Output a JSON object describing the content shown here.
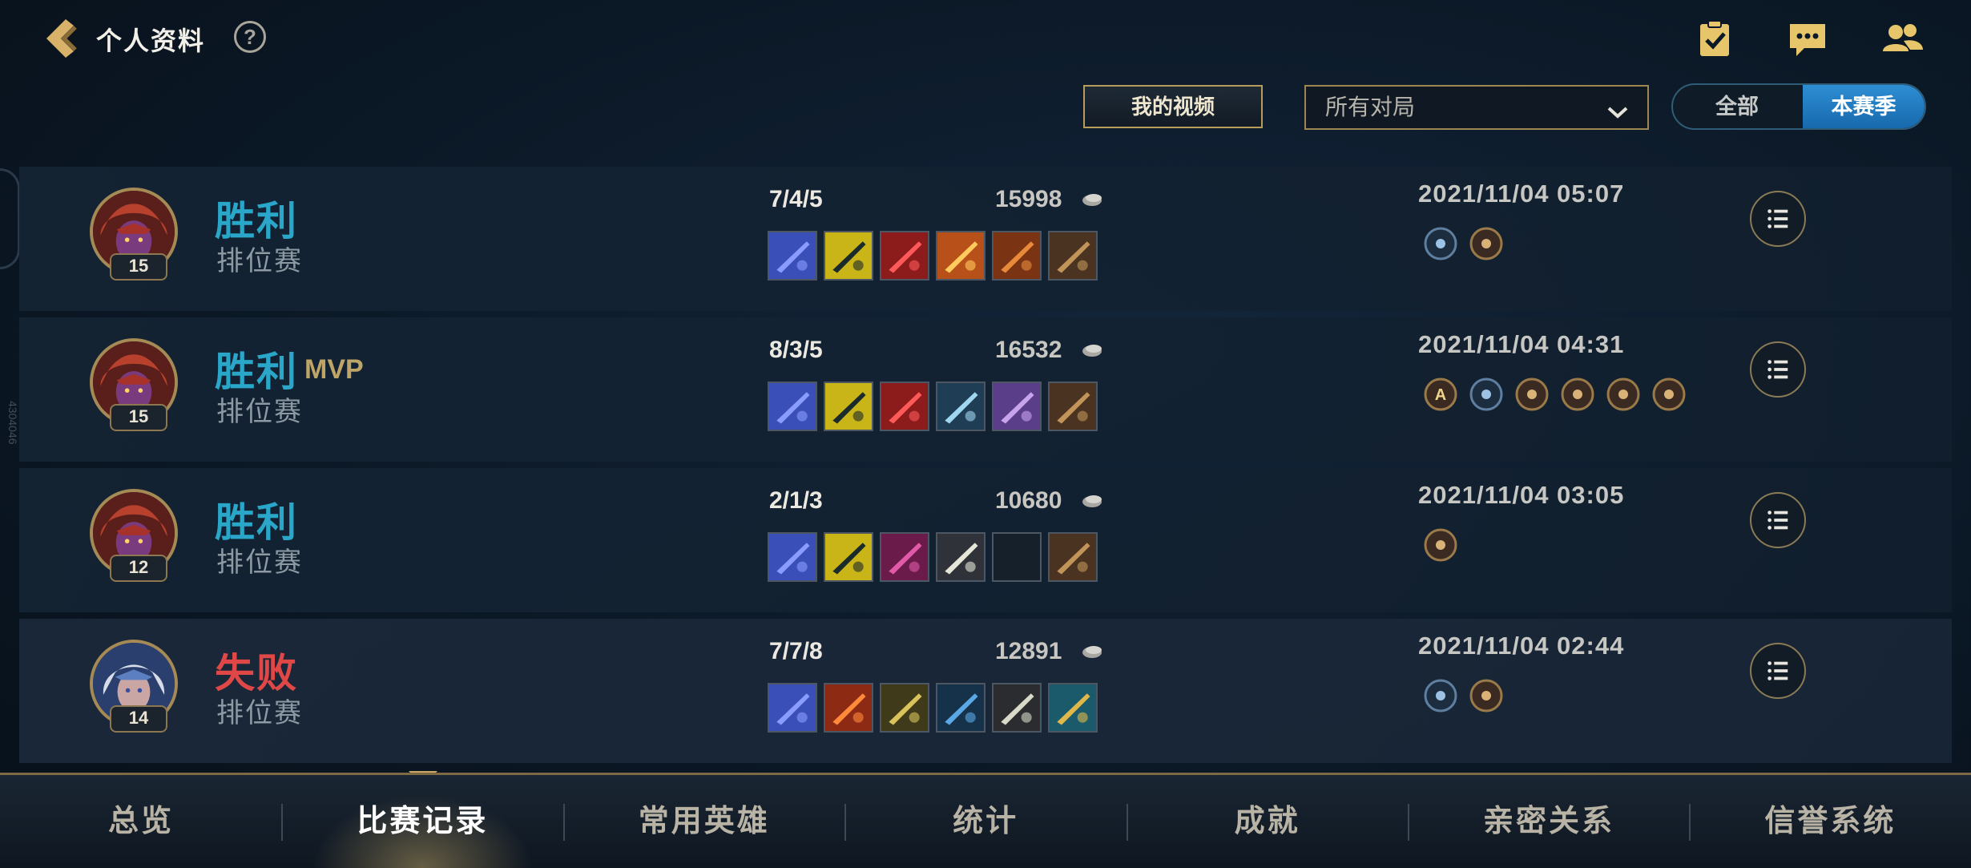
{
  "header": {
    "title": "个人资料",
    "help_label": "?"
  },
  "controls": {
    "video_button": "我的视频",
    "match_filter": "所有对局",
    "segment": [
      "全部",
      "本赛季"
    ],
    "segment_active": "本赛季"
  },
  "side_text": "4304046",
  "matches": [
    {
      "result": "胜利",
      "outcome": "win",
      "mvp": "",
      "mode": "排位赛",
      "level": "15",
      "kda": "7/4/5",
      "gold": "15998",
      "time": "2021/11/04 05:07",
      "badges": [
        "compass-badge",
        "crown-badge"
      ],
      "hero": "red-hero"
    },
    {
      "result": "胜利",
      "outcome": "win",
      "mvp": "MVP",
      "mode": "排位赛",
      "level": "15",
      "kda": "8/3/5",
      "gold": "16532",
      "time": "2021/11/04 04:31",
      "badges": [
        "assist-a-badge",
        "crown-blue-badge",
        "wallet-badge",
        "crown-badge",
        "tower-badge",
        "fist-badge"
      ],
      "hero": "red-hero"
    },
    {
      "result": "胜利",
      "outcome": "win",
      "mvp": "",
      "mode": "排位赛",
      "level": "12",
      "kda": "2/1/3",
      "gold": "10680",
      "time": "2021/11/04 03:05",
      "badges": [
        "crown-badge"
      ],
      "hero": "red-hero"
    },
    {
      "result": "失败",
      "outcome": "lose",
      "mvp": "",
      "mode": "排位赛",
      "level": "14",
      "kda": "7/7/8",
      "gold": "12891",
      "time": "2021/11/04 02:44",
      "badges": [
        "compass-badge",
        "drop-badge"
      ],
      "hero": "blue-hero"
    }
  ],
  "nav": {
    "tabs": [
      "总览",
      "比赛记录",
      "常用英雄",
      "统计",
      "成就",
      "亲密关系",
      "信誉系统"
    ],
    "active": "比赛记录"
  },
  "colors": {
    "win": "#2aa6c9",
    "lose": "#e04848",
    "mvp": "#bfa467",
    "accent_gold": "#b89c5c",
    "segment_active": "#2384c8"
  }
}
